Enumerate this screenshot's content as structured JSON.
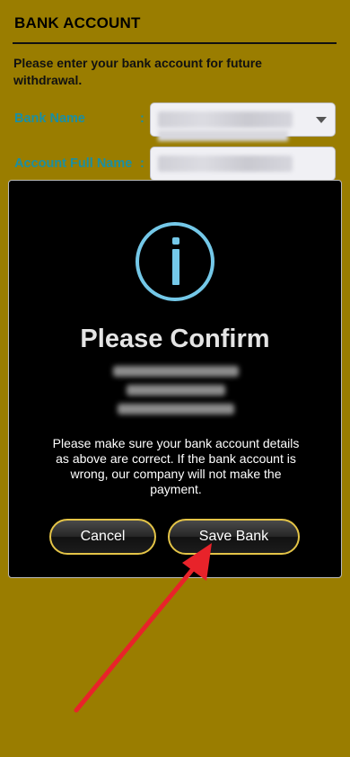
{
  "header": {
    "title": "BANK ACCOUNT"
  },
  "form": {
    "instructions": "Please enter your bank account for future withdrawal.",
    "bank_name_label": "Bank Name",
    "account_full_name_label": "Account Full Name",
    "colon": ":"
  },
  "modal": {
    "title": "Please Confirm",
    "message": "Please make sure your bank account details as above are correct. If the bank account is wrong, our company will not make the payment.",
    "cancel_label": "Cancel",
    "save_label": "Save Bank"
  },
  "colors": {
    "page_background": "#9a7d00",
    "label_teal": "#1a8fa3",
    "icon_blue": "#74c8e8",
    "button_border_gold": "#e4c447",
    "arrow_red": "#e8232a"
  }
}
